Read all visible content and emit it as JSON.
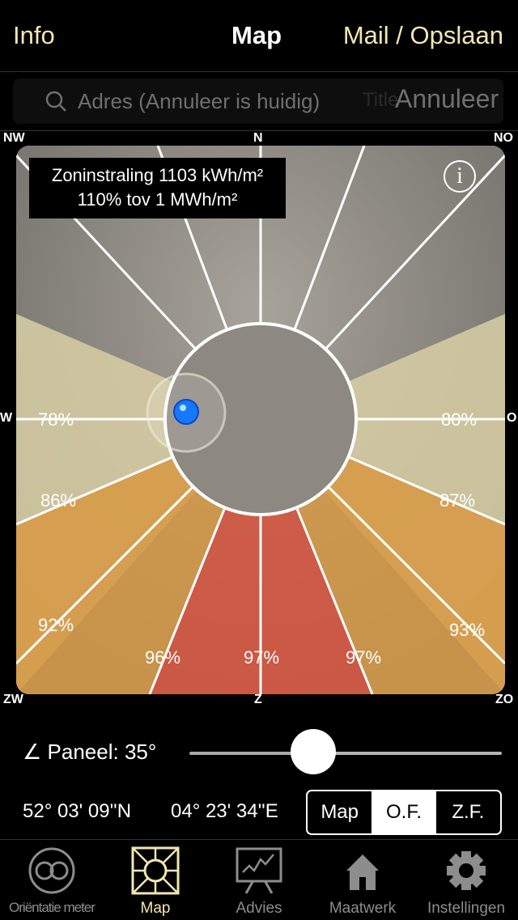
{
  "navbar": {
    "left": "Info",
    "title": "Map",
    "right": "Mail / Opslaan"
  },
  "search": {
    "placeholder": "Adres (Annuleer is huidig)",
    "ghost": "Title",
    "cancel": "Annuleer"
  },
  "compass": {
    "nw": "NW",
    "n": "N",
    "no": "NO",
    "w": "W",
    "o": "O",
    "zw": "ZW",
    "z": "Z",
    "zo": "ZO"
  },
  "irradiation": {
    "line1": "Zoninstraling 1103 kWh/m²",
    "line2": "110% tov 1 MWh/m²"
  },
  "info_icon": "i",
  "percentages": {
    "w": "78%",
    "o": "80%",
    "wzw": "86%",
    "ozo": "87%",
    "zw": "92%",
    "zo": "93%",
    "zzw": "96%",
    "z": "97%",
    "zzo": "97%"
  },
  "panel": {
    "label": "∠ Paneel: 35°",
    "angle_deg": 35,
    "slider_fraction": 0.39
  },
  "coords": {
    "lat": "52° 03' 09''N",
    "lon": "04° 23' 34''E"
  },
  "map_type": {
    "options": [
      "Map",
      "O.F.",
      "Z.F."
    ],
    "selected": "O.F."
  },
  "tabs": [
    {
      "label": "Oriëntatie meter",
      "icon": "orientation-icon"
    },
    {
      "label": "Map",
      "icon": "map-grid-icon",
      "active": true
    },
    {
      "label": "Advies",
      "icon": "chart-board-icon"
    },
    {
      "label": "Maatwerk",
      "icon": "house-icon"
    },
    {
      "label": "Instellingen",
      "icon": "gear-icon"
    }
  ],
  "colors": {
    "accent": "#f3e6b2",
    "south": "#d9553e",
    "southwest": "#d79a45",
    "west": "#d8cfa5"
  }
}
